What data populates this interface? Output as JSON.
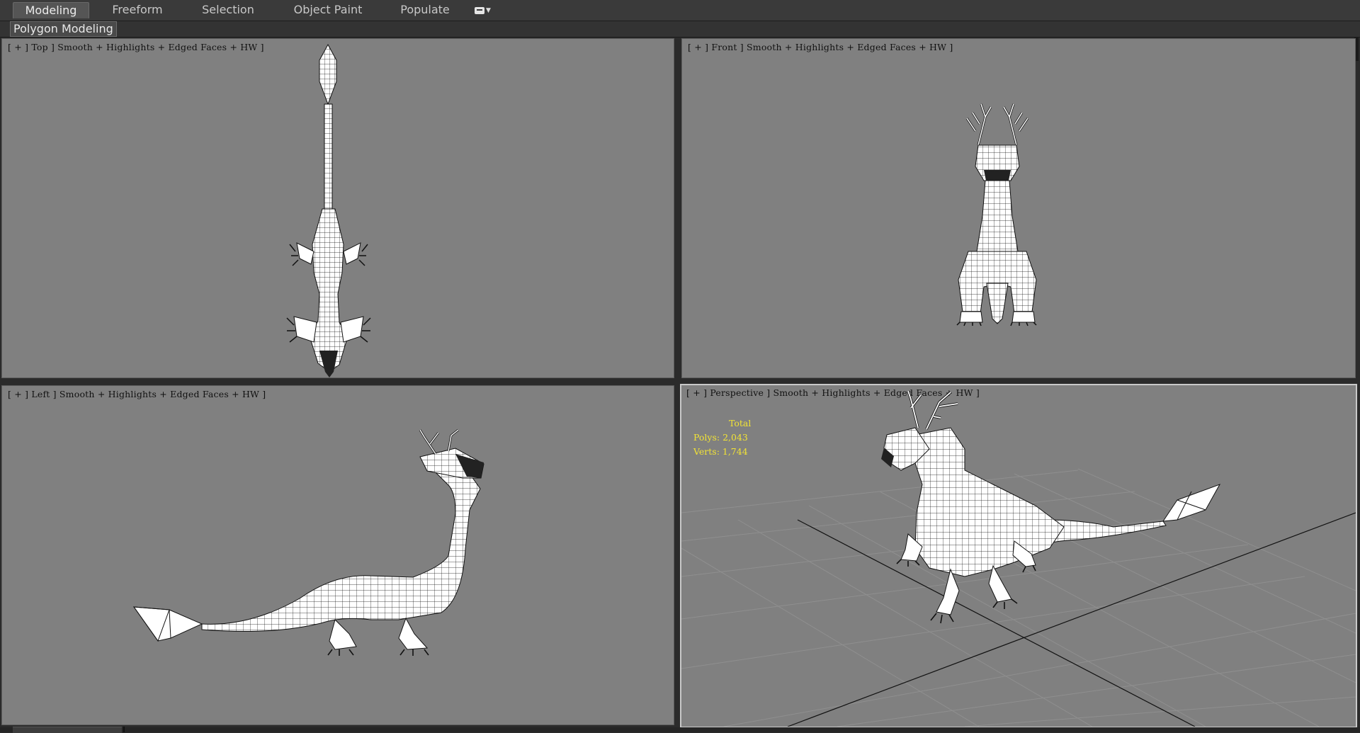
{
  "ribbon": {
    "tabs": [
      {
        "label": "Modeling",
        "active": true
      },
      {
        "label": "Freeform",
        "active": false
      },
      {
        "label": "Selection",
        "active": false
      },
      {
        "label": "Object Paint",
        "active": false
      },
      {
        "label": "Populate",
        "active": false
      }
    ],
    "extra_icon": "options-dropdown-icon"
  },
  "subribbon": {
    "panel_label": "Polygon Modeling"
  },
  "viewports": {
    "top": {
      "label": "[ + ] Top ] Smooth + Highlights + Edged Faces + HW ]"
    },
    "front": {
      "label": "[ + ] Front ] Smooth + Highlights + Edged Faces + HW ]"
    },
    "left": {
      "label": "[ + ] Left ] Smooth + Highlights + Edged Faces + HW ]"
    },
    "perspective": {
      "label": "[ + ] Perspective ] Smooth + Highlights + Edged Faces + HW ]",
      "stats": {
        "total": "Total",
        "polys": "Polys: 2,043",
        "verts": "Verts: 1,744"
      }
    }
  },
  "colors": {
    "viewport_bg": "#808080",
    "stats_text": "#f2e335",
    "ribbon_bg": "#3a3a3a",
    "mesh_fill": "#ffffff",
    "mesh_wire": "#111111"
  }
}
